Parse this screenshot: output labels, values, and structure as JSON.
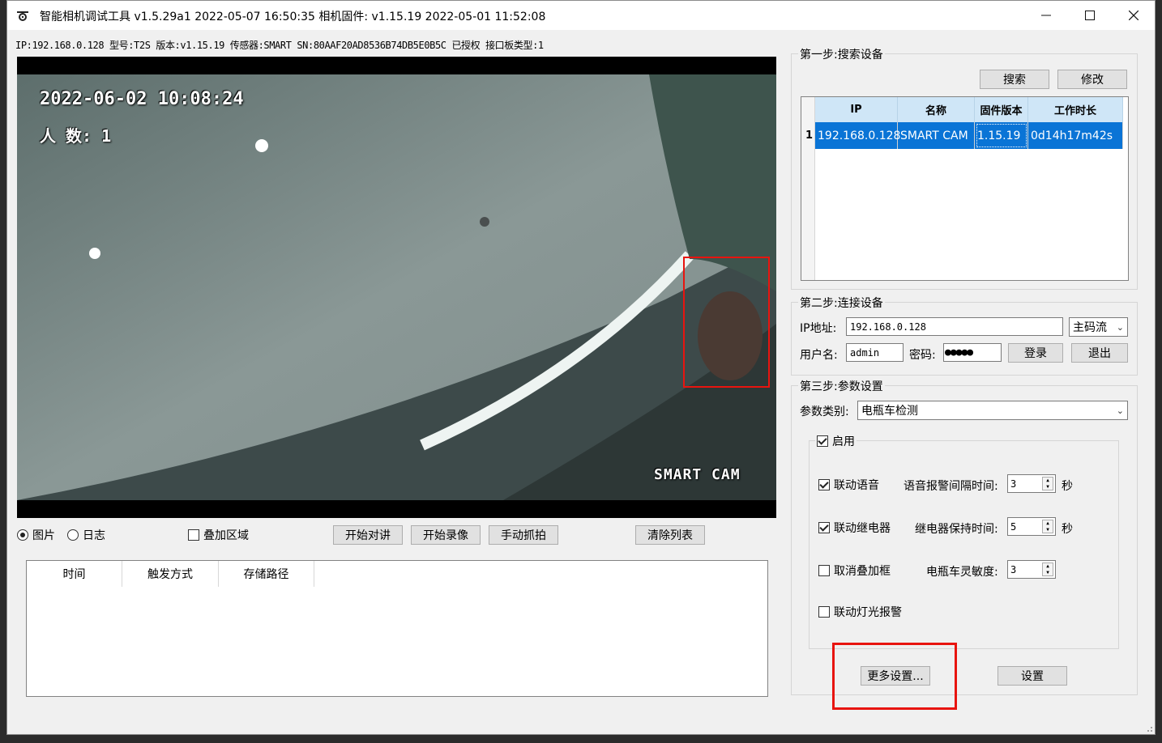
{
  "window": {
    "title": "智能相机调试工具  v1.5.29a1  2022-05-07 16:50:35    相机固件: v1.15.19  2022-05-01 11:52:08"
  },
  "infobar": "IP:192.168.0.128 型号:T2S 版本:v1.15.19  传感器:SMART SN:80AAF20AD8536B74DB5E0B5C 已授权  接口板类型:1",
  "video": {
    "timestamp": "2022-06-02 10:08:24",
    "people_count": "人 数: 1",
    "brand": "SMART CAM"
  },
  "controls": {
    "radio_picture": "图片",
    "radio_log": "日志",
    "overlay_area": "叠加区域",
    "btn_talk": "开始对讲",
    "btn_record": "开始录像",
    "btn_capture": "手动抓拍",
    "btn_clear": "清除列表"
  },
  "log_table": {
    "columns": [
      "时间",
      "触发方式",
      "存储路径"
    ]
  },
  "step1": {
    "title": "第一步:搜索设备",
    "search": "搜索",
    "modify": "修改",
    "columns": [
      "IP",
      "名称",
      "固件版本",
      "工作时长"
    ],
    "rows": [
      {
        "index": "1",
        "ip": "192.168.0.128",
        "name": "SMART CAM",
        "firmware": "1.15.19",
        "uptime": "0d14h17m42s"
      }
    ]
  },
  "step2": {
    "title": "第二步:连接设备",
    "ip_label": "IP地址:",
    "ip_value": "192.168.0.128",
    "stream": "主码流",
    "user_label": "用户名:",
    "user_value": "admin",
    "pass_label": "密码:",
    "pass_value": "●●●●●",
    "login": "登录",
    "logout": "退出"
  },
  "step3": {
    "title": "第三步:参数设置",
    "category_label": "参数类别:",
    "category_value": "电瓶车检测",
    "enable": "启用",
    "link_voice": "联动语音",
    "voice_interval_label": "语音报警间隔时间:",
    "voice_interval": "3",
    "unit_sec": "秒",
    "link_relay": "联动继电器",
    "relay_hold_label": "继电器保持时间:",
    "relay_hold": "5",
    "cancel_overlay": "取消叠加框",
    "sensitivity_label": "电瓶车灵敏度:",
    "sensitivity": "3",
    "link_light": "联动灯光报警",
    "more_settings": "更多设置...",
    "apply": "设置"
  }
}
